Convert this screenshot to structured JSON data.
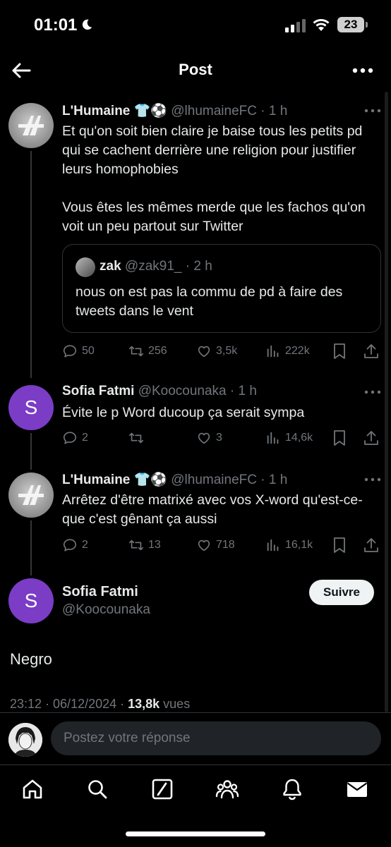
{
  "status_bar": {
    "time": "01:01",
    "battery": "23"
  },
  "header": {
    "title": "Post"
  },
  "tweets": [
    {
      "name": "L'Humaine",
      "emoji": " 👕⚽",
      "handle": "@lhumaineFC",
      "time": " · 1 h",
      "text": "Et qu'on soit bien claire je baise tous les petits pd qui se cachent derrière une religion pour justifier leurs homophobies\n\nVous êtes les mêmes merde que les fachos qu'on voit un peu partout sur Twitter",
      "quote": {
        "name": "zak",
        "handle": "@zak91_",
        "time": " · 2 h",
        "text": "nous on est pas la commu de pd à faire des tweets dans le vent"
      },
      "replies": "50",
      "reposts": "256",
      "likes": "3,5k",
      "views": "222k"
    },
    {
      "name": "Sofia Fatmi",
      "handle": "@Koocounaka",
      "time": " · 1 h",
      "avatar_letter": "S",
      "text": "Évite le p Word ducoup ça serait sympa",
      "replies": "2",
      "reposts": "",
      "likes": "3",
      "views": "14,6k"
    },
    {
      "name": "L'Humaine",
      "emoji": " 👕⚽",
      "handle": "@lhumaineFC",
      "time": " · 1 h",
      "text": "Arrêtez d'être matrixé avec vos X-word qu'est-ce-que c'est gênant ça aussi",
      "replies": "2",
      "reposts": "13",
      "likes": "718",
      "views": "16,1k"
    }
  ],
  "main_post": {
    "name": "Sofia Fatmi",
    "handle": "@Koocounaka",
    "avatar_letter": "S",
    "follow_label": "Suivre",
    "text": "Negro",
    "timestamp": "23:12 · 06/12/2024 · ",
    "views_count": "13,8k",
    "views_label": " vues"
  },
  "reply": {
    "placeholder": "Postez votre réponse"
  },
  "tabs": [
    "home-icon",
    "search-icon",
    "grok-icon",
    "communities-icon",
    "notifications-icon",
    "messages-icon"
  ],
  "colors": {
    "background": "#000000",
    "muted": "#71767b",
    "text": "#e7e9ea",
    "avatar_purple": "#7b3cc6"
  }
}
